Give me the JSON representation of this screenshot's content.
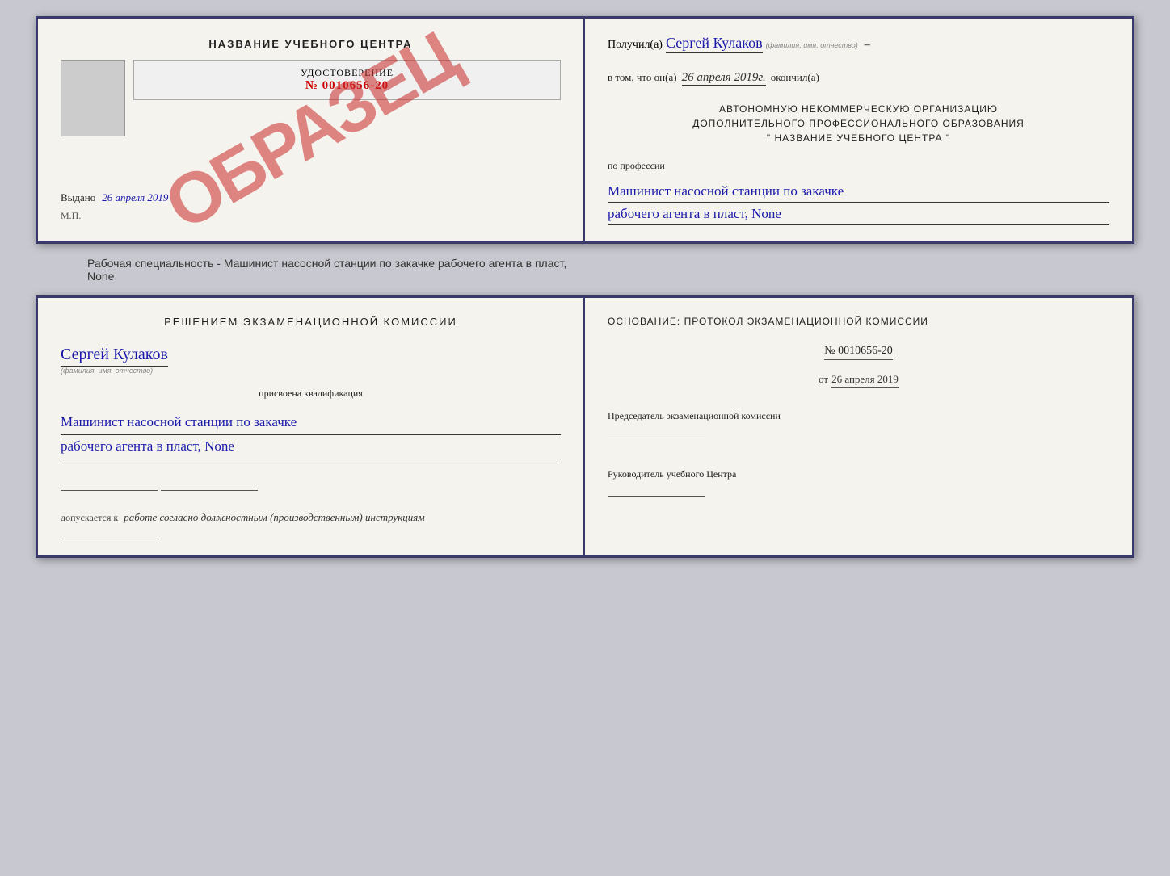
{
  "topDoc": {
    "leftSide": {
      "centerTitle": "НАЗВАНИЕ УЧЕБНОГО ЦЕНТРА",
      "stamp": "ОБРАЗЕЦ",
      "udostoverenie": "УДОСТОВЕРЕНИЕ",
      "certNumber": "№ 0010656-20",
      "vydano": "Выдано",
      "vydanoDate": "26 апреля 2019",
      "mpLabel": "М.П."
    },
    "rightSide": {
      "poluchilLabel": "Получил(а)",
      "fio": "Сергей Кулаков",
      "fioHint": "(фамилия, имя, отчество)",
      "dash": "–",
      "vtomLabel": "в том, что он(а)",
      "vtomDate": "26 апреля 2019г.",
      "okonchilLabel": "окончил(а)",
      "orgTitle1": "АВТОНОМНУЮ НЕКОММЕРЧЕСКУЮ ОРГАНИЗАЦИЮ",
      "orgTitle2": "ДОПОЛНИТЕЛЬНОГО ПРОФЕССИОНАЛЬНОГО ОБРАЗОВАНИЯ",
      "orgName": "\" НАЗВАНИЕ УЧЕБНОГО ЦЕНТРА \"",
      "poProf": "по профессии",
      "profession1": "Машинист насосной станции по закачке",
      "profession2": "рабочего агента в пласт, None"
    }
  },
  "separatorText": "Рабочая специальность - Машинист насосной станции по закачке рабочего агента в пласт,",
  "separatorText2": "None",
  "bottomDoc": {
    "leftSide": {
      "decisionTitle": "Решением экзаменационной комиссии",
      "fio": "Сергей Кулаков",
      "fioHint": "(фамилия, имя, отчество)",
      "prisvoena": "присвоена квалификация",
      "profession1": "Машинист насосной станции по закачке",
      "profession2": "рабочего агента в пласт, None",
      "dopuskaetsyaLabel": "допускается к",
      "dopuskaetsyaText": "работе согласно должностным (производственным) инструкциям"
    },
    "rightSide": {
      "osnovTitle": "Основание: протокол экзаменационной комиссии",
      "protocolNumber": "№ 0010656-20",
      "otLabel": "от",
      "otDate": "26 апреля 2019",
      "predsedatelLabel": "Председатель экзаменационной комиссии",
      "rukovLabel": "Руководитель учебного Центра"
    }
  }
}
